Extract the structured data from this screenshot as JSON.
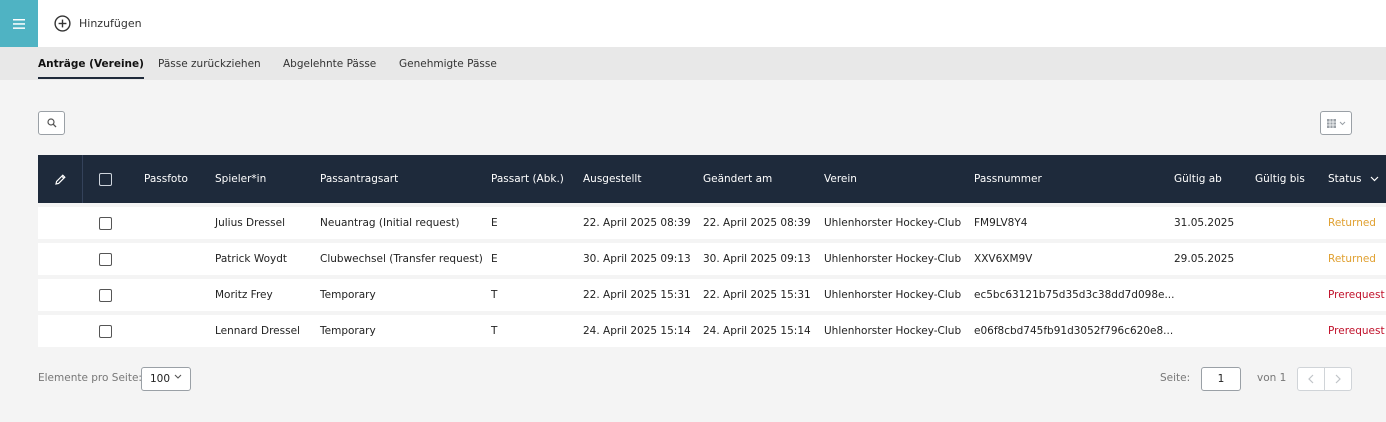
{
  "toolbar": {
    "add_label": "Hinzufügen"
  },
  "tabs": [
    {
      "label": "Anträge (Vereine)",
      "active": true
    },
    {
      "label": "Pässe zurückziehen",
      "active": false
    },
    {
      "label": "Abgelehnte Pässe",
      "active": false
    },
    {
      "label": "Genehmigte Pässe",
      "active": false
    }
  ],
  "table": {
    "headers": {
      "passfoto": "Passfoto",
      "spieler": "Spieler*in",
      "passantragsart": "Passantragsart",
      "passart": "Passart (Abk.)",
      "ausgestellt": "Ausgestellt",
      "geaendert": "Geändert am",
      "verein": "Verein",
      "passnummer": "Passnummer",
      "gueltig_ab": "Gültig ab",
      "gueltig_bis": "Gültig bis",
      "status": "Status"
    },
    "rows": [
      {
        "spieler": "Julius Dressel",
        "passantragsart": "Neuantrag (Initial request)",
        "passart": "E",
        "ausgestellt": "22. April 2025 08:39",
        "geaendert": "22. April 2025 08:39",
        "verein": "Uhlenhorster Hockey-Club",
        "passnummer": "FM9LV8Y4",
        "gueltig_ab": "31.05.2025",
        "gueltig_bis": "",
        "status": "Returned"
      },
      {
        "spieler": "Patrick Woydt",
        "passantragsart": "Clubwechsel (Transfer request)",
        "passart": "E",
        "ausgestellt": "30. April 2025 09:13",
        "geaendert": "30. April 2025 09:13",
        "verein": "Uhlenhorster Hockey-Club",
        "passnummer": "XXV6XM9V",
        "gueltig_ab": "29.05.2025",
        "gueltig_bis": "",
        "status": "Returned"
      },
      {
        "spieler": "Moritz Frey",
        "passantragsart": "Temporary",
        "passart": "T",
        "ausgestellt": "22. April 2025 15:31",
        "geaendert": "22. April 2025 15:31",
        "verein": "Uhlenhorster Hockey-Club",
        "passnummer": "ec5bc63121b75d35d3c38dd7d098e...",
        "gueltig_ab": "",
        "gueltig_bis": "",
        "status": "Prerequest"
      },
      {
        "spieler": "Lennard Dressel",
        "passantragsart": "Temporary",
        "passart": "T",
        "ausgestellt": "24. April 2025 15:14",
        "geaendert": "24. April 2025 15:14",
        "verein": "Uhlenhorster Hockey-Club",
        "passnummer": "e06f8cbd745fb91d3052f796c620e8...",
        "gueltig_ab": "",
        "gueltig_bis": "",
        "status": "Prerequest"
      }
    ]
  },
  "pagination": {
    "per_page_label": "Elemente pro Seite:",
    "per_page_value": "100",
    "page_label": "Seite:",
    "page_value": "1",
    "of_label": "von 1"
  },
  "colors": {
    "menu_button": "#4fb3c3",
    "table_header": "#1e2a3b",
    "status_returned": "#e0a030",
    "status_prerequest": "#c0102a"
  },
  "icons": [
    "menu-icon",
    "add-circle-icon",
    "search-icon",
    "columns-grid-icon",
    "edit-pencil-icon",
    "sort-chevron-icon",
    "chevron-left-icon",
    "chevron-right-icon"
  ]
}
